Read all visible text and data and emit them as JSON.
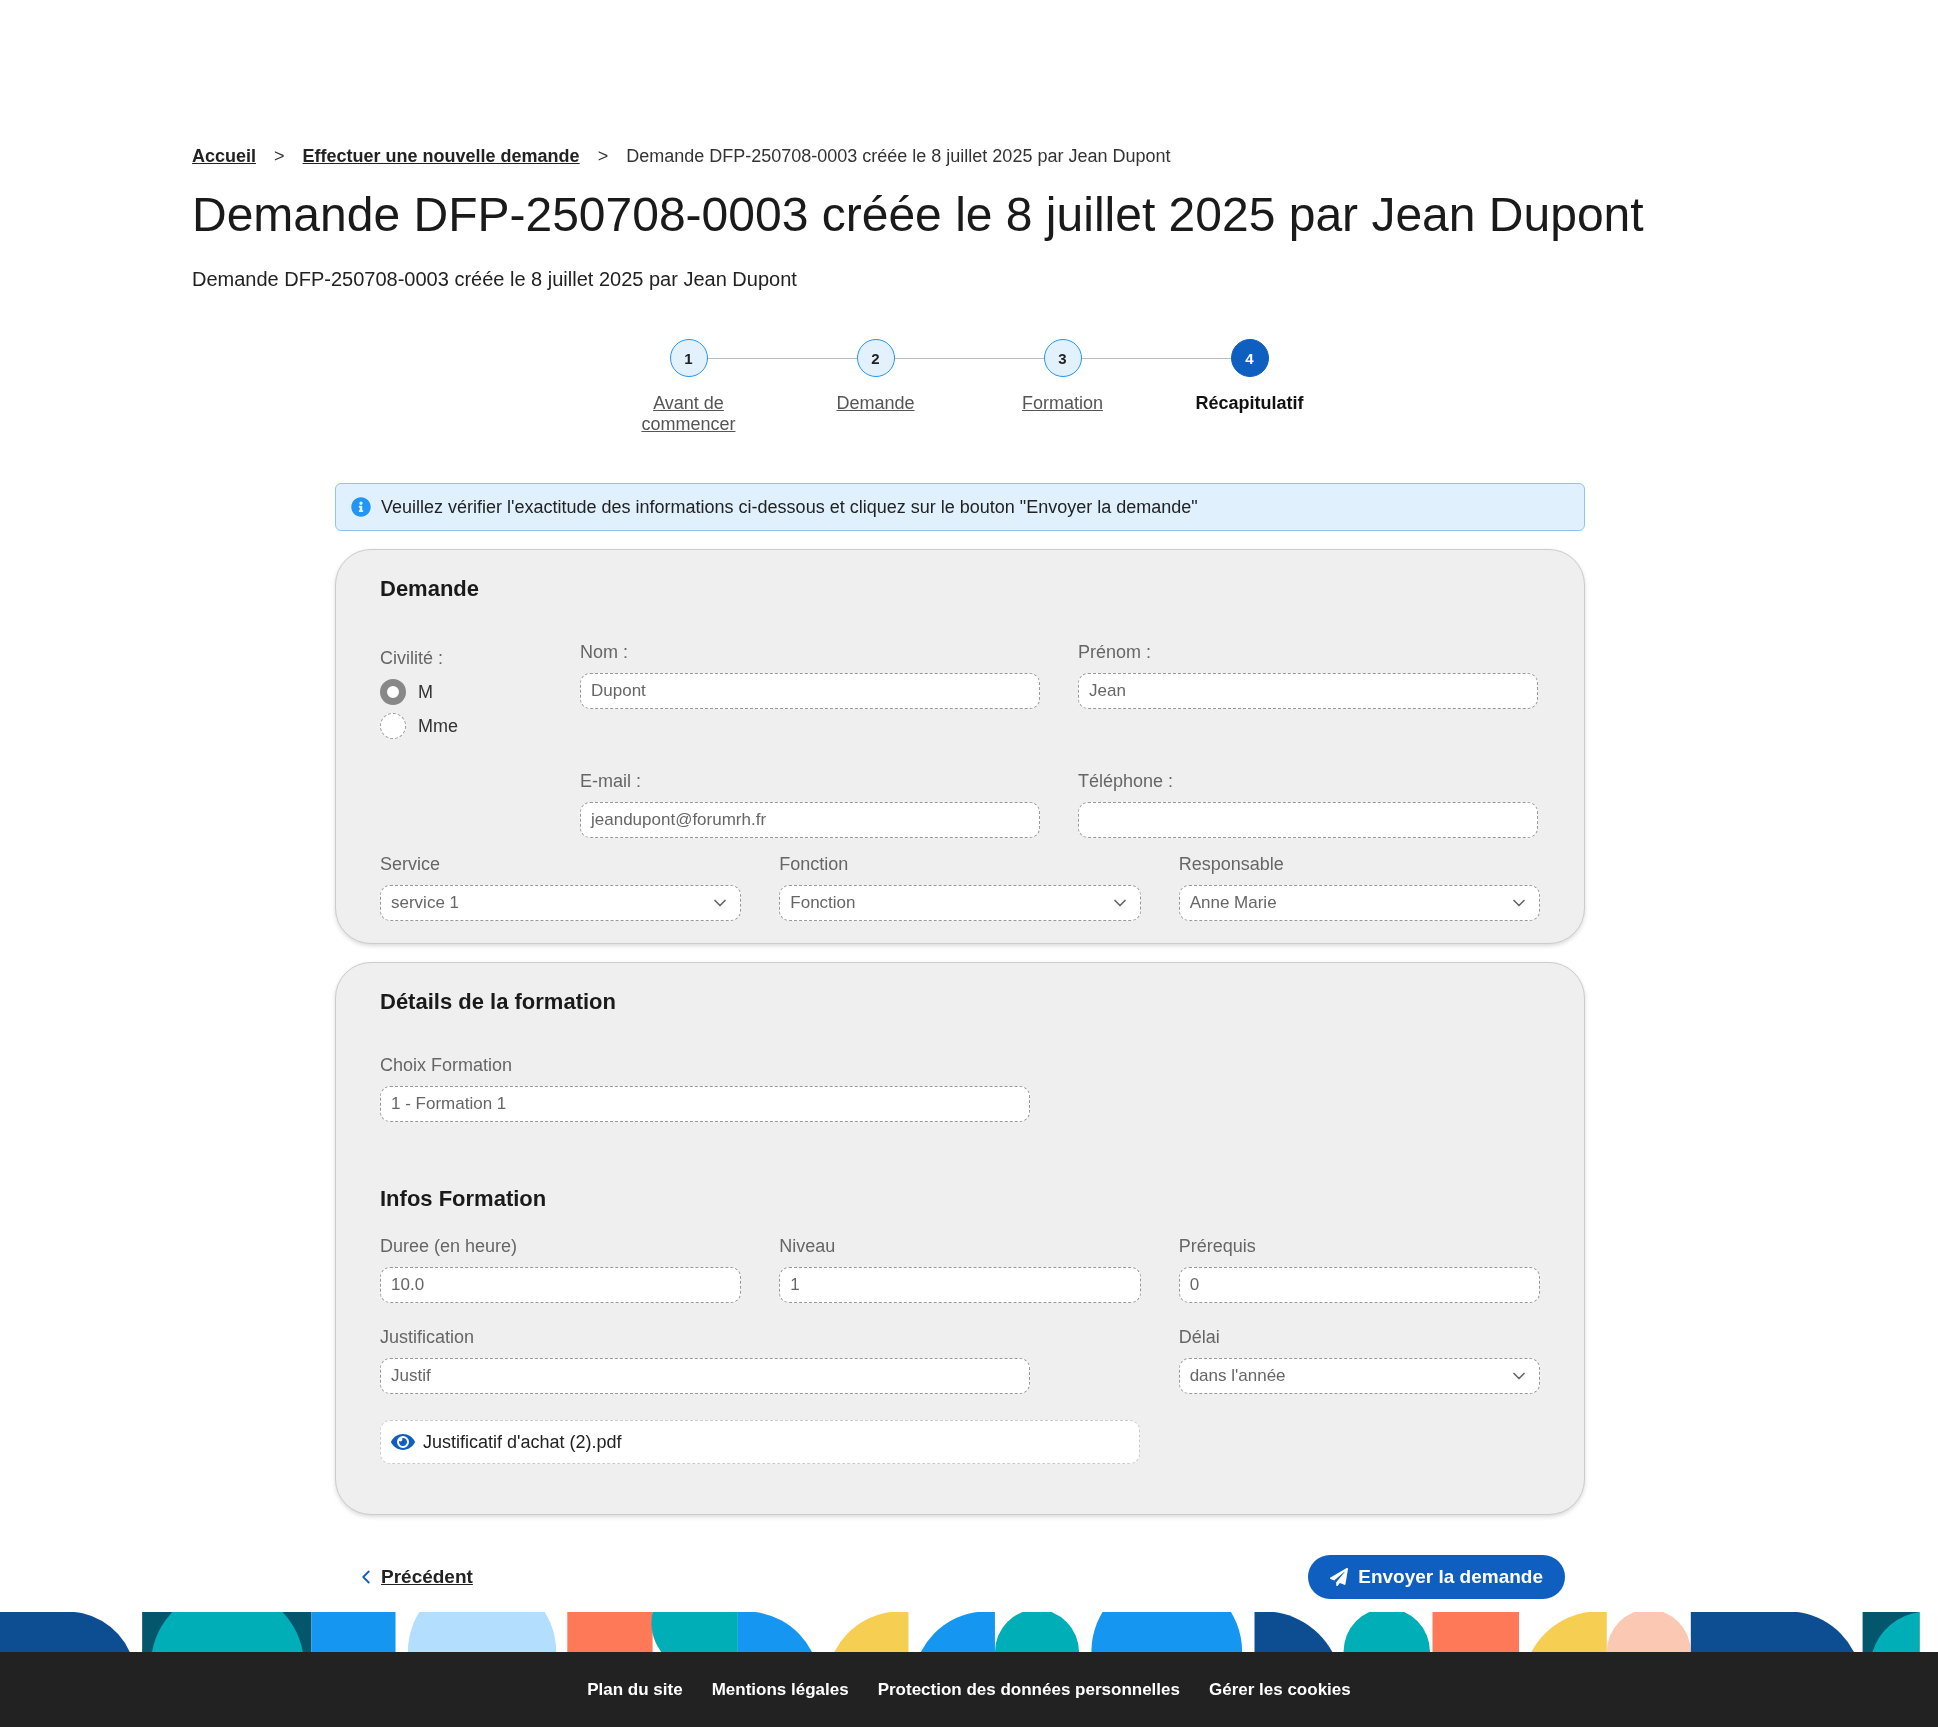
{
  "breadcrumb": [
    {
      "label": "Accueil",
      "link": true
    },
    {
      "label": "Effectuer une nouvelle demande",
      "link": true
    },
    {
      "label": "Demande DFP-250708-0003 créée le 8 juillet 2025 par Jean Dupont",
      "link": false
    }
  ],
  "separator": ">",
  "title": "Demande DFP-250708-0003 créée le 8 juillet 2025 par Jean Dupont",
  "subtitle": "Demande DFP-250708-0003 créée le 8 juillet 2025 par Jean Dupont",
  "steps": [
    {
      "number": "1",
      "label": "Avant de commencer",
      "selected": false
    },
    {
      "number": "2",
      "label": "Demande",
      "selected": false
    },
    {
      "number": "3",
      "label": "Formation",
      "selected": false
    },
    {
      "number": "4",
      "label": "Récapitulatif",
      "selected": true
    }
  ],
  "info_banner": "Veuillez vérifier l'exactitude des informations ci-dessous et cliquez sur le bouton \"Envoyer la demande\"",
  "demande": {
    "title": "Demande",
    "civilite": {
      "label": "Civilité :",
      "options": [
        {
          "label": "M",
          "selected": true
        },
        {
          "label": "Mme",
          "selected": false
        }
      ]
    },
    "nom": {
      "label": "Nom :",
      "value": "Dupont"
    },
    "prenom": {
      "label": "Prénom :",
      "value": "Jean"
    },
    "email": {
      "label": "E-mail :",
      "value": "jeandupont@forumrh.fr"
    },
    "telephone": {
      "label": "Téléphone :"
    },
    "selects": [
      {
        "label": "Service",
        "value": "service 1"
      },
      {
        "label": "Fonction",
        "value": "Fonction"
      },
      {
        "label": "Responsable",
        "value": "Anne Marie"
      }
    ]
  },
  "formation": {
    "title": "Détails de la formation",
    "choix": {
      "label": "Choix Formation",
      "value": "1 - Formation 1"
    },
    "infos_title": "Infos Formation",
    "infos": [
      {
        "label": "Duree (en heure)",
        "value": "10.0",
        "kind": "text"
      },
      {
        "label": "Niveau",
        "value": "1",
        "kind": "text"
      },
      {
        "label": "Prérequis",
        "value": "0",
        "kind": "text"
      }
    ],
    "justification": {
      "label": "Justification",
      "value": "Justif",
      "kind": "text"
    },
    "delai": {
      "label": "Délai",
      "value": "dans l'année",
      "kind": "select"
    },
    "attachment": "Justificatif d'achat (2).pdf"
  },
  "previous_button": "Précédent",
  "submit_button": "Envoyer la demande",
  "footer_links": [
    "Plan du site",
    "Mentions légales",
    "Protection des données personnelles",
    "Gérer les cookies"
  ]
}
